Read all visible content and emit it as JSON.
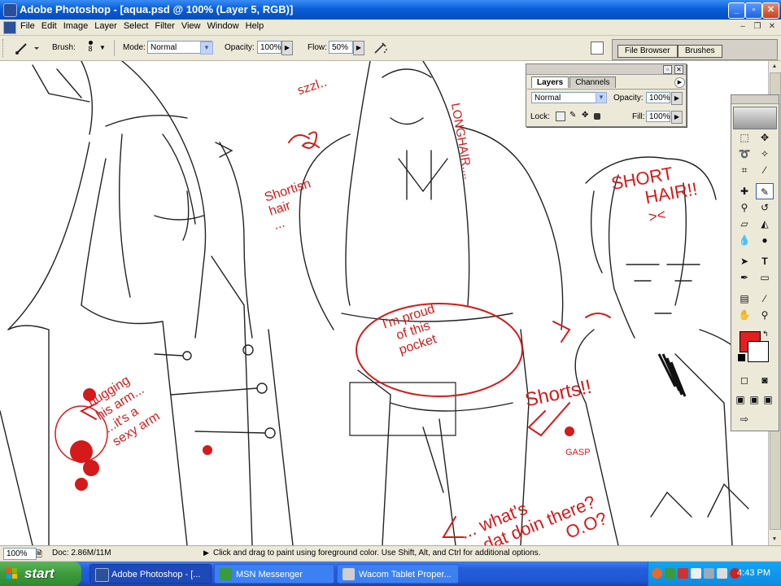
{
  "window": {
    "title": "Adobe Photoshop - [aqua.psd @ 100% (Layer 5, RGB)]"
  },
  "menu": [
    "File",
    "Edit",
    "Image",
    "Layer",
    "Select",
    "Filter",
    "View",
    "Window",
    "Help"
  ],
  "options": {
    "brush_label": "Brush:",
    "brush_size": "8",
    "mode_label": "Mode:",
    "mode_value": "Normal",
    "opacity_label": "Opacity:",
    "opacity_value": "100%",
    "flow_label": "Flow:",
    "flow_value": "50%"
  },
  "palette_well": {
    "tabs": [
      "File Browser",
      "Brushes"
    ]
  },
  "layers_palette": {
    "tabs": [
      "Layers",
      "Channels"
    ],
    "blend_mode": "Normal",
    "opacity_label": "Opacity:",
    "opacity_value": "100%",
    "lock_label": "Lock:",
    "fill_label": "Fill:",
    "fill_value": "100%"
  },
  "tools": {
    "foreground_color": "#e02020",
    "background_color": "#ffffff"
  },
  "canvas_annotations": {
    "szzl": "szzl..",
    "longhair": "LONGHAIR....",
    "shortish": [
      "Shortish",
      "hair",
      "..."
    ],
    "short_hair": [
      "SHORT",
      "HAIR!!",
      "><"
    ],
    "proud": [
      "I'm proud",
      "of this",
      "pocket"
    ],
    "shorts": "Shorts!!",
    "gasp": "GASP",
    "hugging": [
      "hugging",
      "his arm...",
      "...it's a",
      "sexy arm"
    ],
    "whats": [
      "... what's",
      "dat doin there?",
      "O.O?"
    ],
    "ink_color": "#d41a1a"
  },
  "status": {
    "zoom": "100%",
    "doc": "Doc: 2.86M/11M",
    "hint": "Click and drag to paint using foreground color.  Use Shift, Alt, and Ctrl for additional options."
  },
  "taskbar": {
    "start": "start",
    "buttons": [
      "Adobe Photoshop - [...",
      "MSN Messenger",
      "Wacom Tablet Proper..."
    ],
    "clock": "4:43 PM"
  }
}
